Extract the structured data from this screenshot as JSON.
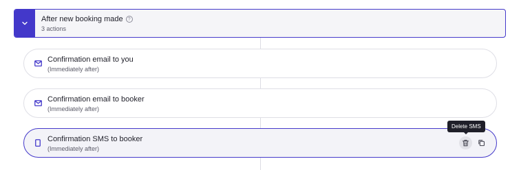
{
  "trigger": {
    "title": "After new booking made",
    "subtitle": "3 actions",
    "toggle_icon": "chevron-down-icon",
    "help_icon": "help-circle-icon",
    "help_glyph": "?"
  },
  "actions": [
    {
      "title": "Confirmation email to you",
      "subtitle": "(Immediately after)",
      "icon": "mail-icon"
    },
    {
      "title": "Confirmation email to booker",
      "subtitle": "(Immediately after)",
      "icon": "mail-icon"
    },
    {
      "title": "Confirmation SMS to booker",
      "subtitle": "(Immediately after)",
      "icon": "phone-icon",
      "selected": true
    }
  ],
  "tooltip": {
    "text": "Delete SMS"
  },
  "colors": {
    "accent": "#4338ca",
    "border": "#dedee5",
    "muted_text": "#5b5b68"
  }
}
